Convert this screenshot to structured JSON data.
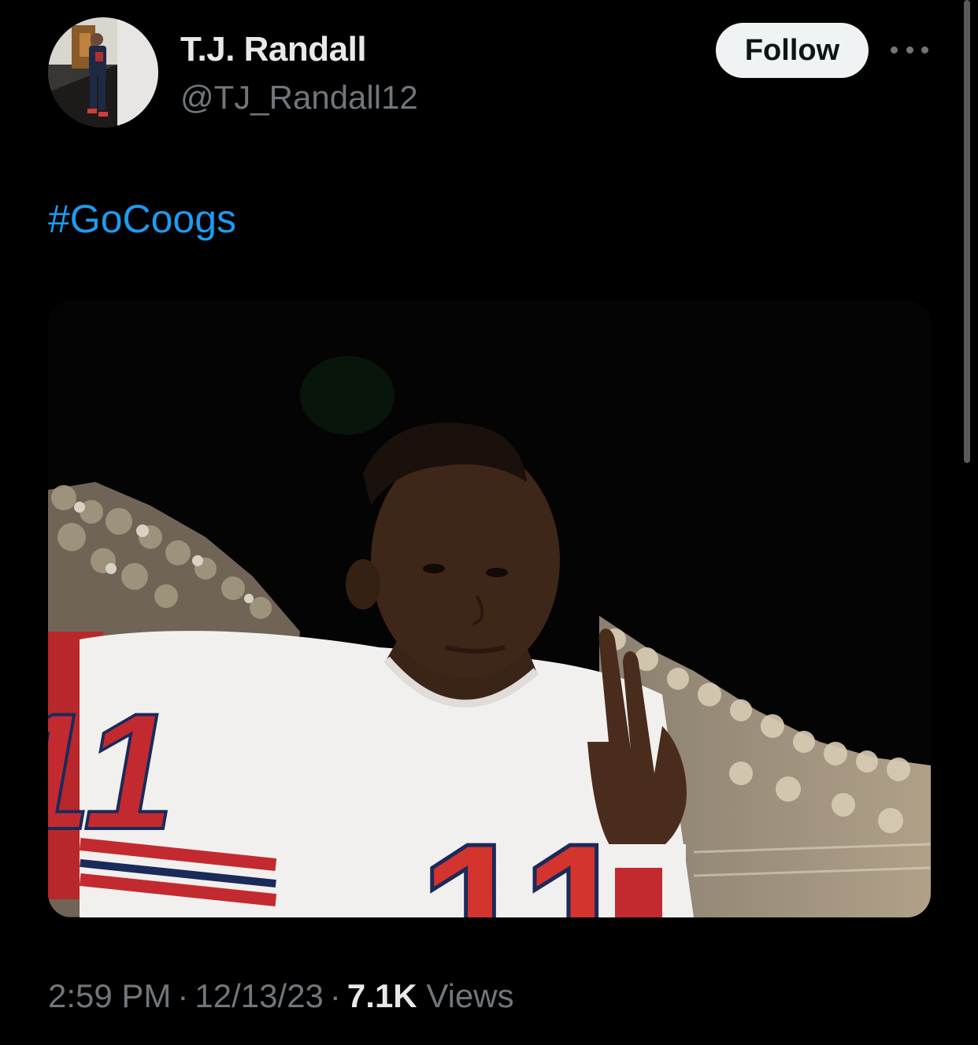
{
  "author": {
    "display_name": "T.J. Randall",
    "handle": "@TJ_Randall12"
  },
  "header": {
    "follow_label": "Follow",
    "more_icon": "more-horizontal-icon"
  },
  "tweet": {
    "hashtag": "#GoCoogs"
  },
  "media": {
    "jersey_number": "11"
  },
  "meta": {
    "time": "2:59 PM",
    "separator": "·",
    "date": "12/13/23",
    "views_count": "7.1K",
    "views_label": "Views"
  },
  "colors": {
    "background": "#000000",
    "link": "#1d9bf0",
    "primary_text": "#e7e9ea",
    "secondary_text": "#71767b",
    "follow_button_bg": "#eff3f4"
  }
}
